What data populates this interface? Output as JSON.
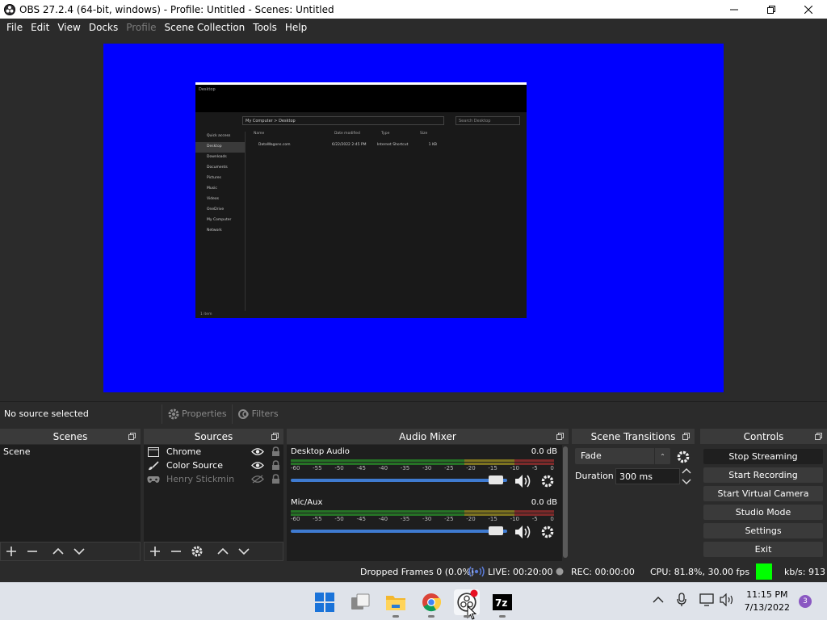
{
  "window": {
    "title": "OBS 27.2.4 (64-bit, windows) - Profile: Untitled - Scenes: Untitled"
  },
  "menu": [
    "File",
    "Edit",
    "View",
    "Docks",
    "Profile",
    "Scene Collection",
    "Tools",
    "Help"
  ],
  "menu_disabled": [
    "Profile"
  ],
  "preview": {
    "canvas_color": "#0000ff",
    "captured_window": {
      "title": "Desktop",
      "breadcrumb": "My Computer  >  Desktop",
      "search_placeholder": "Search Desktop",
      "sidebar": [
        "Quick access",
        "Desktop",
        "Downloads",
        "Documents",
        "Pictures",
        "Music",
        "Videos",
        "OneDrive",
        "My Computer",
        "Network"
      ],
      "columns": [
        "Name",
        "Date modified",
        "Type",
        "Size"
      ],
      "row": [
        "DataWagons.com",
        "6/22/2022 2:45 PM",
        "Internet Shortcut",
        "1 KB"
      ],
      "footer": "1 item"
    }
  },
  "context_bar": {
    "no_source": "No source selected",
    "properties": "Properties",
    "filters": "Filters"
  },
  "scenes": {
    "header": "Scenes",
    "items": [
      "Scene"
    ]
  },
  "sources": {
    "header": "Sources",
    "items": [
      {
        "name": "Chrome",
        "icon": "window-capture-icon",
        "visible": true
      },
      {
        "name": "Color Source",
        "icon": "brush-icon",
        "visible": true
      },
      {
        "name": "Henry Stickmin",
        "icon": "gamepad-icon",
        "visible": false
      }
    ]
  },
  "mixer": {
    "header": "Audio Mixer",
    "ticks": [
      "-60",
      "-55",
      "-50",
      "-45",
      "-40",
      "-35",
      "-30",
      "-25",
      "-20",
      "-15",
      "-10",
      "-5",
      "0"
    ],
    "channels": [
      {
        "name": "Desktop Audio",
        "db": "0.0 dB",
        "volume": 0.95
      },
      {
        "name": "Mic/Aux",
        "db": "0.0 dB",
        "volume": 0.95
      }
    ]
  },
  "transitions": {
    "header": "Scene Transitions",
    "selected": "Fade",
    "duration_label": "Duration",
    "duration_value": "300 ms"
  },
  "controls": {
    "header": "Controls",
    "buttons": [
      "Stop Streaming",
      "Start Recording",
      "Start Virtual Camera",
      "Studio Mode",
      "Settings",
      "Exit"
    ]
  },
  "status": {
    "dropped": "Dropped Frames 0 (0.0%)",
    "live": "LIVE: 00:20:00",
    "rec": "REC: 00:00:00",
    "cpu": "CPU: 81.8%, 30.00 fps",
    "kbs": "kb/s: 913",
    "indicator_color": "#00ff00"
  },
  "taskbar": {
    "time": "11:15 PM",
    "date": "7/13/2022",
    "notifications": "3"
  }
}
